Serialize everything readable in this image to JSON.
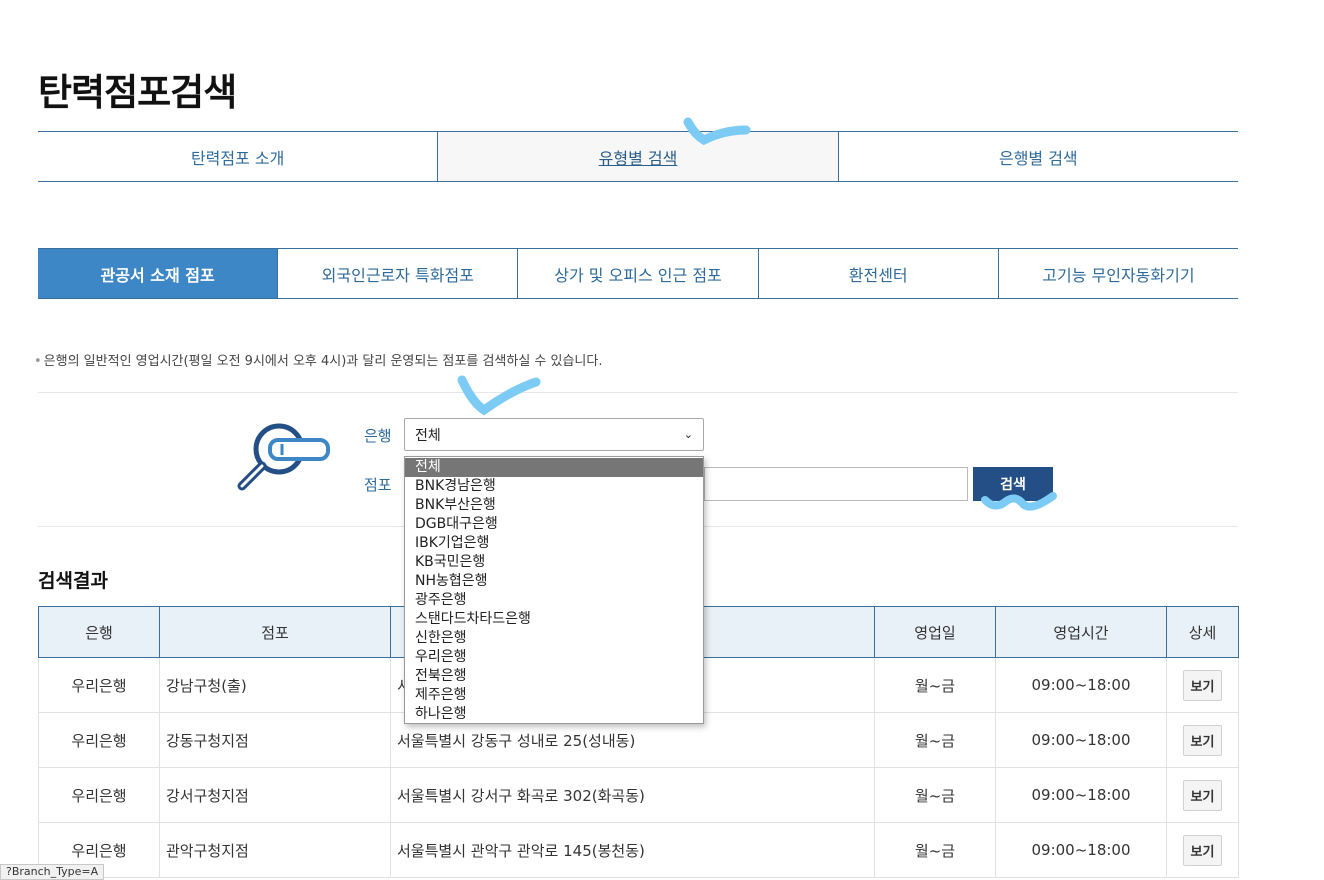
{
  "page": {
    "title": "탄력점포검색"
  },
  "top_tabs": [
    {
      "label": "탄력점포 소개"
    },
    {
      "label": "유형별 검색"
    },
    {
      "label": "은행별 검색"
    }
  ],
  "sub_tabs": [
    {
      "label": "관공서 소재 점포"
    },
    {
      "label": "외국인근로자 특화점포"
    },
    {
      "label": "상가 및 오피스 인근 점포"
    },
    {
      "label": "환전센터"
    },
    {
      "label": "고기능 무인자동화기기"
    }
  ],
  "notice": "은행의 일반적인 영업시간(평일 오전 9시에서 오후 4시)과 달리 운영되는 점포를 검색하실 수 있습니다.",
  "search_form": {
    "bank_label": "은행",
    "bank_selected": "전체",
    "branch_label": "점포",
    "branch_value": "",
    "search_button": "검색"
  },
  "bank_options": [
    "전체",
    "BNK경남은행",
    "BNK부산은행",
    "DGB대구은행",
    "IBK기업은행",
    "KB국민은행",
    "NH농협은행",
    "광주은행",
    "스탠다드차타드은행",
    "신한은행",
    "우리은행",
    "전북은행",
    "제주은행",
    "하나은행"
  ],
  "results": {
    "title": "검색결과",
    "headers": [
      "은행",
      "점포",
      "주소",
      "영업일",
      "영업시간",
      "상세"
    ],
    "rows": [
      {
        "bank": "우리은행",
        "branch": "강남구청(출)",
        "address": "서",
        "days": "월~금",
        "hours": "09:00~18:00",
        "detail": "보기"
      },
      {
        "bank": "우리은행",
        "branch": "강동구청지점",
        "address": "서울특별시 강동구 성내로 25(성내동)",
        "days": "월~금",
        "hours": "09:00~18:00",
        "detail": "보기"
      },
      {
        "bank": "우리은행",
        "branch": "강서구청지점",
        "address": "서울특별시 강서구 화곡로 302(화곡동)",
        "days": "월~금",
        "hours": "09:00~18:00",
        "detail": "보기"
      },
      {
        "bank": "우리은행",
        "branch": "관악구청지점",
        "address": "서울특별시 관악구 관악로 145(봉천동)",
        "days": "월~금",
        "hours": "09:00~18:00",
        "detail": "보기"
      }
    ]
  },
  "status_bar": "?Branch_Type=A",
  "colors": {
    "accent": "#3d87c6",
    "border_blue": "#3a6f99",
    "button_dark": "#234f86",
    "annotation": "#7ccbf5"
  }
}
